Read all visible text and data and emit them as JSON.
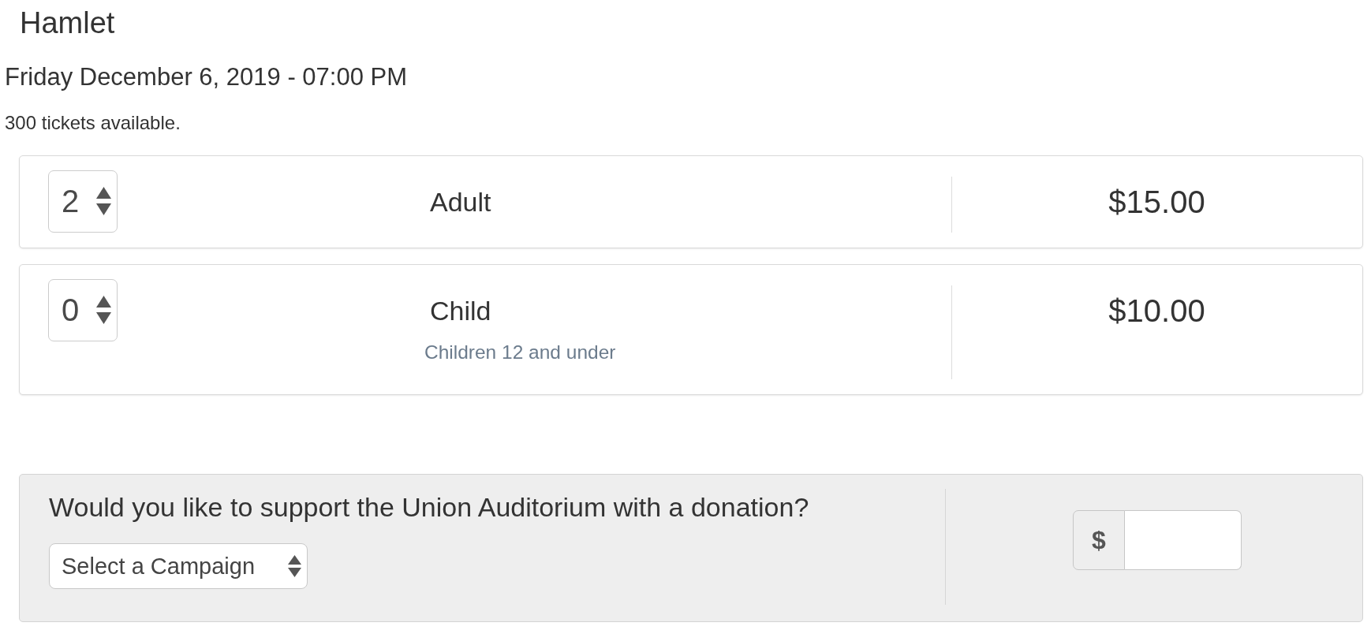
{
  "event": {
    "title": "Hamlet",
    "datetime": "Friday December 6, 2019 - 07:00 PM",
    "availability": "300 tickets available."
  },
  "tickets": [
    {
      "quantity": "2",
      "name": "Adult",
      "price": "$15.00"
    },
    {
      "quantity": "0",
      "name": "Child",
      "description": "Children 12 and under",
      "price": "$10.00"
    }
  ],
  "donation": {
    "question": "Would you like to support the Union Auditorium with a donation?",
    "campaign_select": {
      "value": "Select a Campaign"
    },
    "amount": {
      "prefix": "$"
    }
  }
}
